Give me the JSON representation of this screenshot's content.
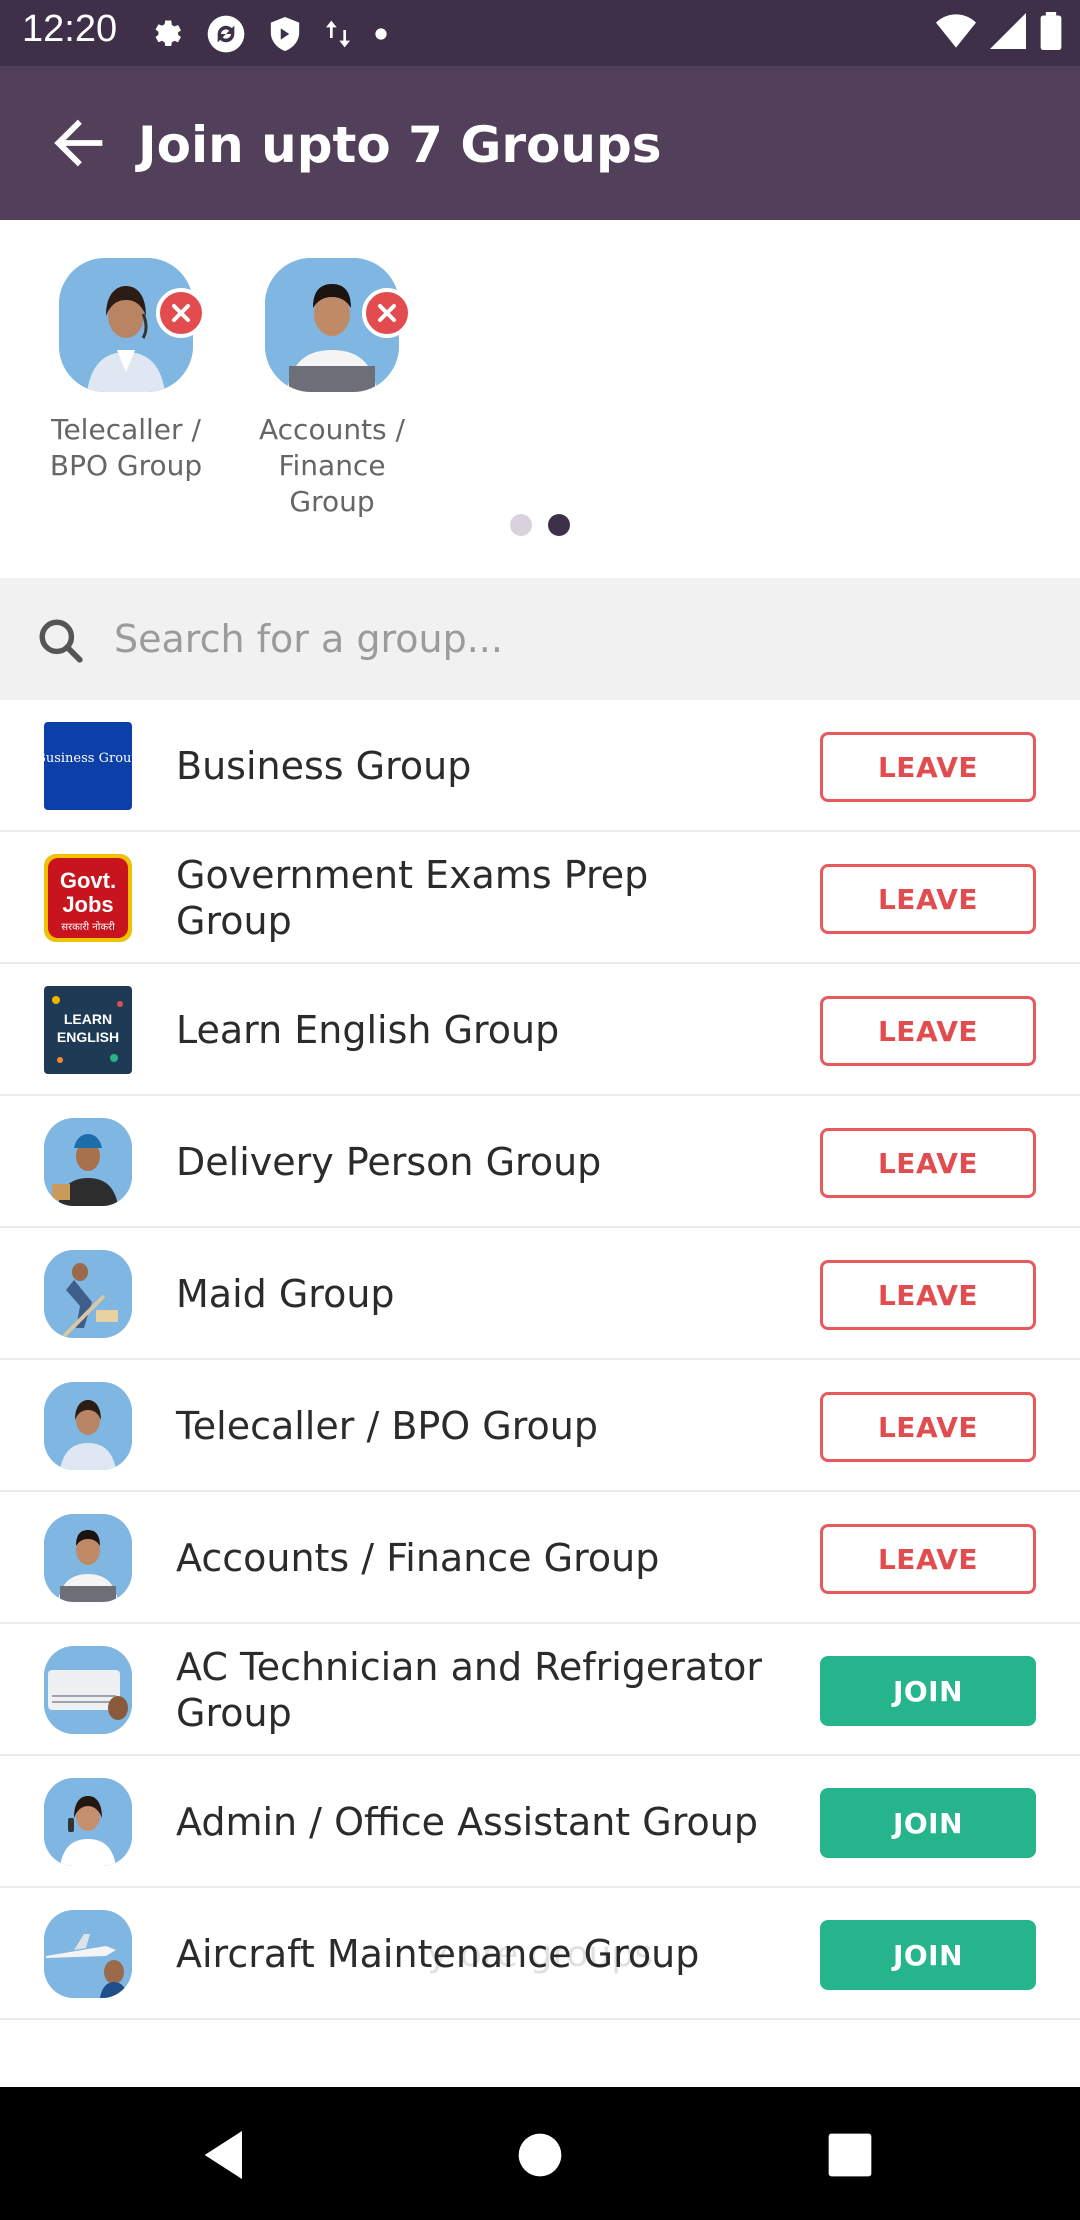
{
  "status_bar": {
    "time": "12:20",
    "left_icons": [
      "settings-icon",
      "sync-icon",
      "shield-icon",
      "data-arrows-icon",
      "dot-icon"
    ],
    "right_icons": [
      "wifi-icon",
      "signal-icon",
      "battery-icon"
    ]
  },
  "app_bar": {
    "title": "Join upto 7 Groups",
    "back_icon": "arrow-left-icon",
    "color": "#523f5a"
  },
  "selected_groups": [
    {
      "label": "Telecaller / BPO Group",
      "icon": "telecaller-avatar"
    },
    {
      "label": "Accounts / Finance Group",
      "icon": "accounts-avatar"
    }
  ],
  "pager": {
    "total": 2,
    "active": 2
  },
  "search": {
    "placeholder": "Search for a group...",
    "value": ""
  },
  "groups": [
    {
      "name": "Business Group",
      "action": "LEAVE",
      "icon": "business-logo",
      "logo_text": "Business Group"
    },
    {
      "name": "Government Exams Prep Group",
      "action": "LEAVE",
      "icon": "govt-jobs-logo",
      "logo_text": "Govt. Jobs",
      "logo_subtext": "सरकारी नोकरी"
    },
    {
      "name": "Learn English Group",
      "action": "LEAVE",
      "icon": "learn-english-logo",
      "logo_text": "LEARN ENGLISH"
    },
    {
      "name": "Delivery Person Group",
      "action": "LEAVE",
      "icon": "delivery-avatar"
    },
    {
      "name": "Maid Group",
      "action": "LEAVE",
      "icon": "maid-avatar"
    },
    {
      "name": "Telecaller / BPO Group",
      "action": "LEAVE",
      "icon": "telecaller-avatar"
    },
    {
      "name": "Accounts / Finance Group",
      "action": "LEAVE",
      "icon": "accounts-avatar"
    },
    {
      "name": "AC Technician and Refrigerator Group",
      "action": "JOIN",
      "icon": "ac-technician-avatar"
    },
    {
      "name": "Admin / Office Assistant Group",
      "action": "JOIN",
      "icon": "admin-avatar"
    },
    {
      "name": "Aircraft Maintenance Group",
      "action": "JOIN",
      "icon": "aircraft-avatar"
    }
  ],
  "ghost_hint": "y     ore groups",
  "colors": {
    "status_bar": "#3e3049",
    "leave": "#e24c4f",
    "join": "#26b48c",
    "remove": "#e24c4f"
  },
  "nav_bar": {
    "icons": [
      "back-triangle-icon",
      "home-circle-icon",
      "recents-square-icon"
    ]
  }
}
